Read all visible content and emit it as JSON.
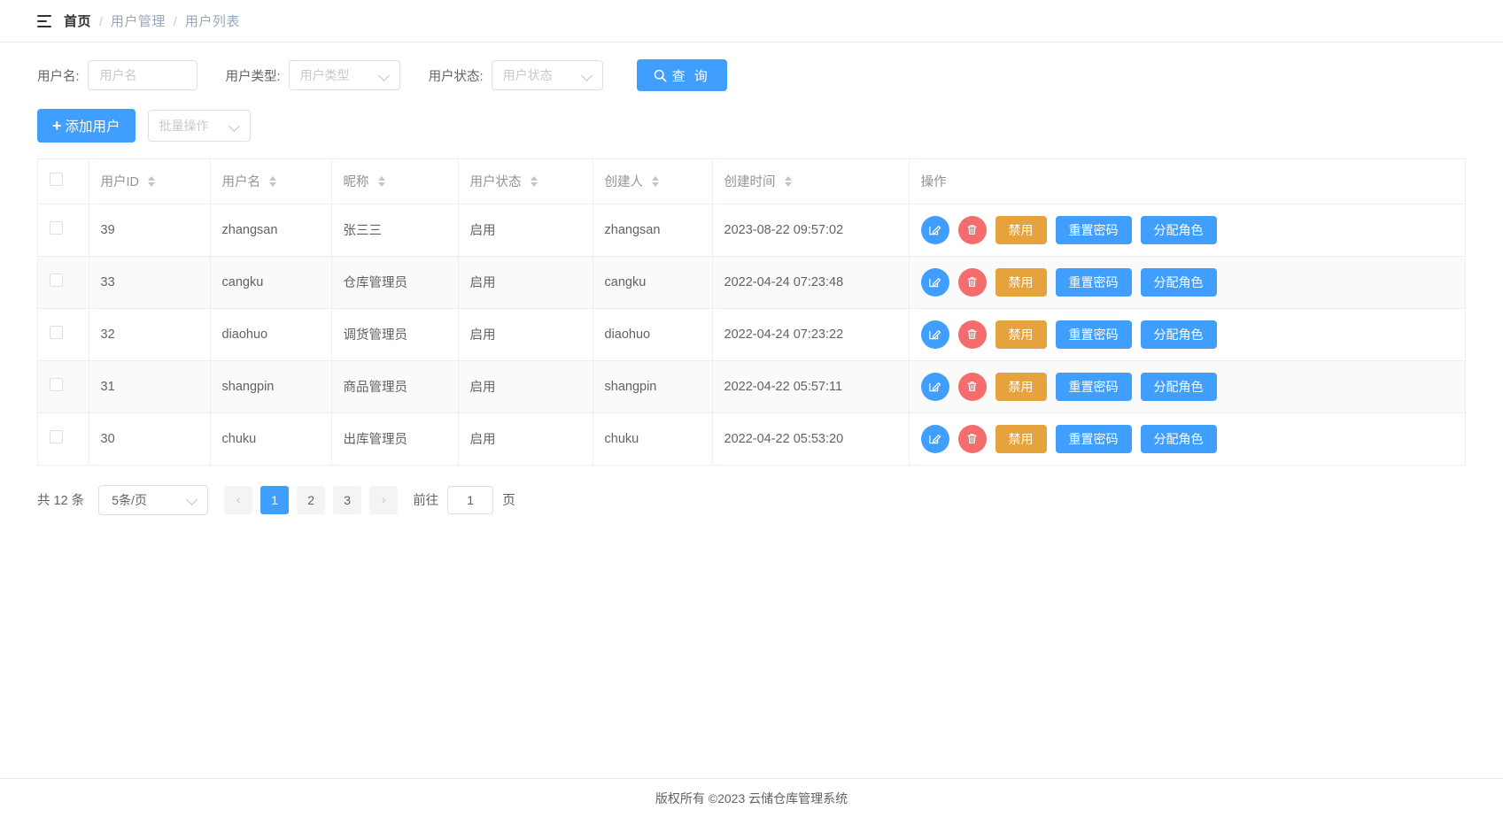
{
  "breadcrumb": {
    "menu_icon": "hamburger-icon",
    "items": [
      {
        "label": "首页",
        "current": true
      },
      {
        "label": "用户管理",
        "current": false
      },
      {
        "label": "用户列表",
        "current": false
      }
    ],
    "separator": "/"
  },
  "filters": {
    "username": {
      "label": "用户名:",
      "value": "",
      "placeholder": "用户名"
    },
    "usertype": {
      "label": "用户类型:",
      "value": "用户类型"
    },
    "userstate": {
      "label": "用户状态:",
      "value": "用户状态"
    },
    "query_button": {
      "label": "查 询",
      "icon": "search-icon"
    }
  },
  "toolbar": {
    "add_label": "添加用户",
    "add_icon": "plus-icon",
    "batch_label": "批量操作",
    "batch_icon": "chevron-down-icon"
  },
  "table": {
    "columns": [
      {
        "key": "check",
        "label": "",
        "sortable": false
      },
      {
        "key": "id",
        "label": "用户ID",
        "sortable": true
      },
      {
        "key": "username",
        "label": "用户名",
        "sortable": true
      },
      {
        "key": "nickname",
        "label": "昵称",
        "sortable": true
      },
      {
        "key": "state",
        "label": "用户状态",
        "sortable": true
      },
      {
        "key": "creator",
        "label": "创建人",
        "sortable": true
      },
      {
        "key": "created",
        "label": "创建时间",
        "sortable": true
      },
      {
        "key": "ops",
        "label": "操作",
        "sortable": false
      }
    ],
    "rows": [
      {
        "id": "39",
        "username": "zhangsan",
        "nickname": "张三三",
        "state": "启用",
        "creator": "zhangsan",
        "created": "2023-08-22 09:57:02"
      },
      {
        "id": "33",
        "username": "cangku",
        "nickname": "仓库管理员",
        "state": "启用",
        "creator": "cangku",
        "created": "2022-04-24 07:23:48"
      },
      {
        "id": "32",
        "username": "diaohuo",
        "nickname": "调货管理员",
        "state": "启用",
        "creator": "diaohuo",
        "created": "2022-04-24 07:23:22"
      },
      {
        "id": "31",
        "username": "shangpin",
        "nickname": "商品管理员",
        "state": "启用",
        "creator": "shangpin",
        "created": "2022-04-22 05:57:11"
      },
      {
        "id": "30",
        "username": "chuku",
        "nickname": "出库管理员",
        "state": "启用",
        "creator": "chuku",
        "created": "2022-04-22 05:53:20"
      }
    ],
    "row_actions": {
      "edit_icon": "edit-icon",
      "delete_icon": "trash-icon",
      "disable_label": "禁用",
      "reset_password_label": "重置密码",
      "assign_role_label": "分配角色"
    }
  },
  "pagination": {
    "total_text": "共 12 条",
    "page_size_label": "5条/页",
    "prev_icon": "chevron-left-icon",
    "next_icon": "chevron-right-icon",
    "pages": [
      "1",
      "2",
      "3"
    ],
    "active_page": "1",
    "jump_prefix": "前往",
    "jump_value": "1",
    "jump_suffix": "页"
  },
  "footer": {
    "text": "版权所有 ©2023  云储仓库管理系统"
  },
  "colors": {
    "primary": "#409eff",
    "warning": "#e6a23c",
    "danger": "#f56c6c",
    "text": "#606266",
    "muted": "#909399"
  }
}
